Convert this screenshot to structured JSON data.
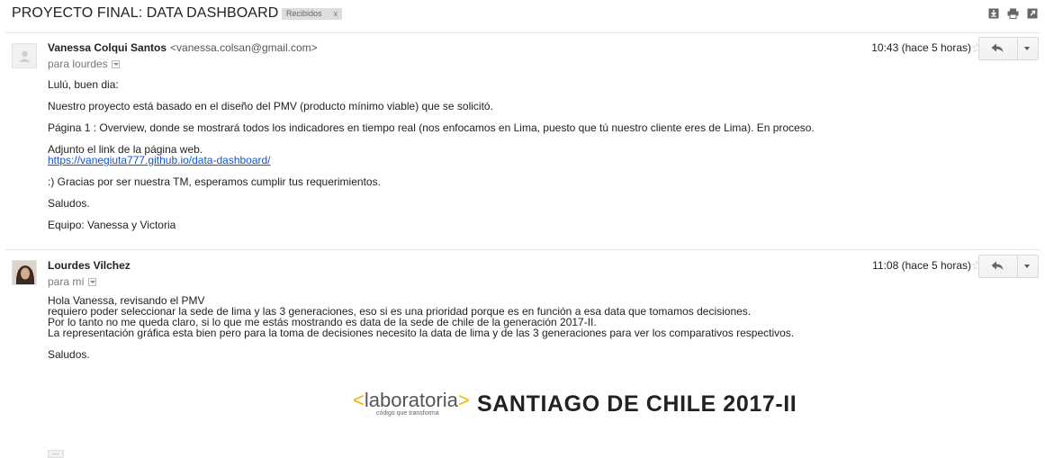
{
  "thread": {
    "subject": "PROYECTO FINAL: DATA DASHBOARD",
    "label_chip": "Recibidos",
    "label_remove": "x"
  },
  "toolbar_icons": [
    "download-all-icon",
    "print-icon",
    "new-window-icon"
  ],
  "messages": [
    {
      "sender_name": "Vanessa Colqui Santos",
      "sender_email": "<vanessa.colsan@gmail.com>",
      "recipient": "para lourdes",
      "time": "10:43 (hace 5 horas)",
      "body": {
        "p1": "Lulú, buen dia:",
        "p2": "Nuestro proyecto está basado en el diseño del PMV (producto mínimo viable) que se solicitó.",
        "p3": "Página 1 : Overview, donde se mostrará todos los indicadores en tiempo real (nos enfocamos en Lima, puesto que tú nuestro cliente eres de Lima). En proceso.",
        "p4": "Adjunto el link de la página web.",
        "link": "https://vanegiuta777.github.io/data-dashboard/",
        "p5": ":) Gracias por ser nuestra TM, esperamos cumplir tus requerimientos.",
        "p6": "Saludos.",
        "p7": "Equipo: Vanessa y Victoria"
      }
    },
    {
      "sender_name": "Lourdes Vilchez",
      "recipient": "para mí",
      "time": "11:08 (hace 5 horas)",
      "body": {
        "l1": "Hola Vanessa, revisando el PMV",
        "l2": "requiero poder seleccionar la sede de lima y las 3 generaciones, eso si es una prioridad porque es en función a esa data que tomamos decisiones.",
        "l3": "Por lo tanto no me queda claro, si lo que me estás mostrando es data de la sede de chile de la generación 2017-II.",
        "l4": "La representación gráfica esta bien pero para la toma de decisiones necesito la data de lima y de las 3 generaciones para ver los comparativos respectivos.",
        "l5": "Saludos."
      },
      "banner": {
        "logo_open": "<",
        "logo_text": "laboratoria",
        "logo_close": ">",
        "logo_tagline": "código que transforma",
        "title": "SANTIAGO DE CHILE 2017-II"
      },
      "trimmed_content": "..."
    }
  ],
  "colors": {
    "link": "#1155cc",
    "brand_accent": "#f5b400",
    "label_chip_bg": "#dddddd",
    "separator": "#e5e5e5"
  }
}
